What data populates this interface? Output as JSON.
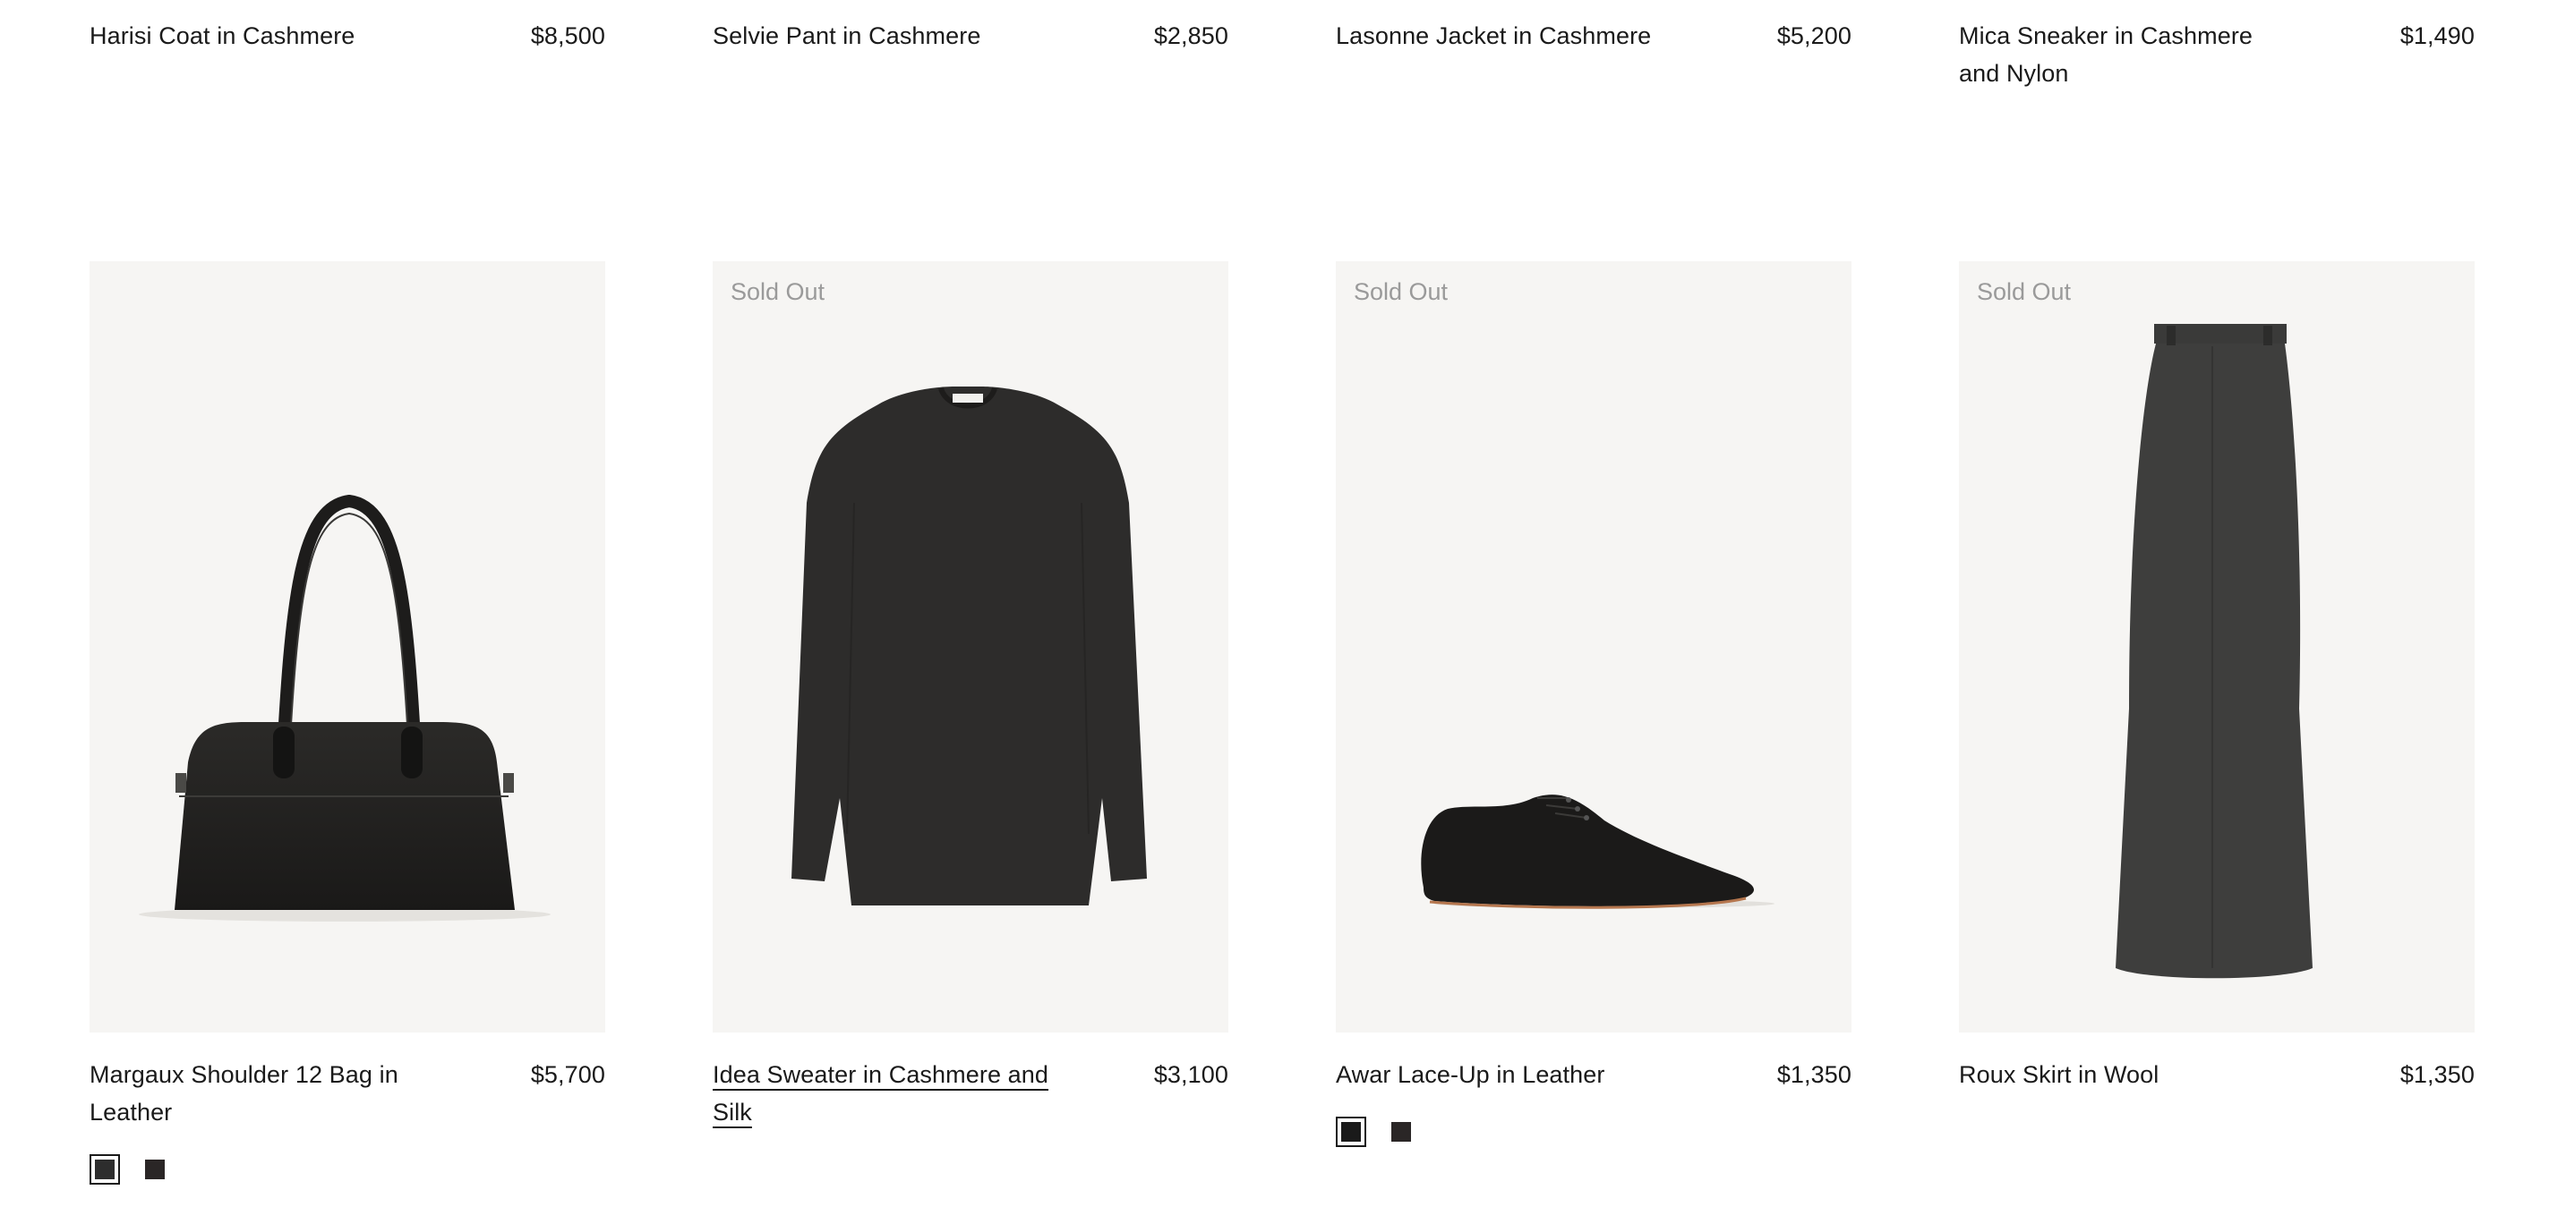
{
  "top_row": [
    {
      "name": "Harisi Coat in Cashmere",
      "price": "$8,500"
    },
    {
      "name": "Selvie Pant in Cashmere",
      "price": "$2,850"
    },
    {
      "name": "Lasonne Jacket in Cashmere",
      "price": "$5,200"
    },
    {
      "name": "Mica Sneaker in Cashmere and Nylon",
      "price": "$1,490"
    }
  ],
  "products": [
    {
      "name": "Margaux Shoulder 12 Bag in Leather",
      "price": "$5,700",
      "badge": "",
      "image_icon": "handbag-image",
      "swatches": [
        "#222222",
        "#2a2626"
      ]
    },
    {
      "name": "Idea Sweater in Cashmere and Silk",
      "price": "$3,100",
      "badge": "Sold Out",
      "image_icon": "sweater-image",
      "swatches": []
    },
    {
      "name": "Awar Lace-Up in Leather",
      "price": "$1,350",
      "badge": "Sold Out",
      "image_icon": "shoe-image",
      "swatches": [
        "#1a1a1a",
        "#2a2626"
      ]
    },
    {
      "name": "Roux Skirt in Wool",
      "price": "$1,350",
      "badge": "Sold Out",
      "image_icon": "skirt-image",
      "swatches": []
    }
  ],
  "colors": {
    "image_background": "#f6f5f3",
    "badge_text": "#9a9a9a",
    "text": "#1a1a1a"
  }
}
